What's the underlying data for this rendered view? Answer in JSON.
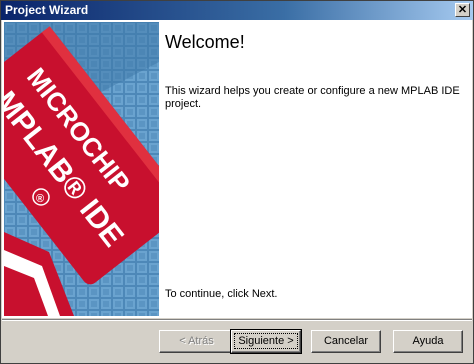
{
  "window": {
    "title": "Project Wizard",
    "close_glyph": "✕"
  },
  "banner": {
    "brand_line1": "MICROCHIP",
    "brand_line2": "MPLAB® IDE",
    "registered_mark": "®",
    "colors": {
      "red": "#c8102e",
      "blue": "#4d88b8",
      "white": "#ffffff"
    }
  },
  "main": {
    "heading": "Welcome!",
    "description": "This wizard helps you create or configure a new MPLAB IDE project.",
    "footer_text": "To continue, click Next."
  },
  "buttons": {
    "back": "< Atrás",
    "next": "Siguiente >",
    "cancel": "Cancelar",
    "help": "Ayuda"
  }
}
